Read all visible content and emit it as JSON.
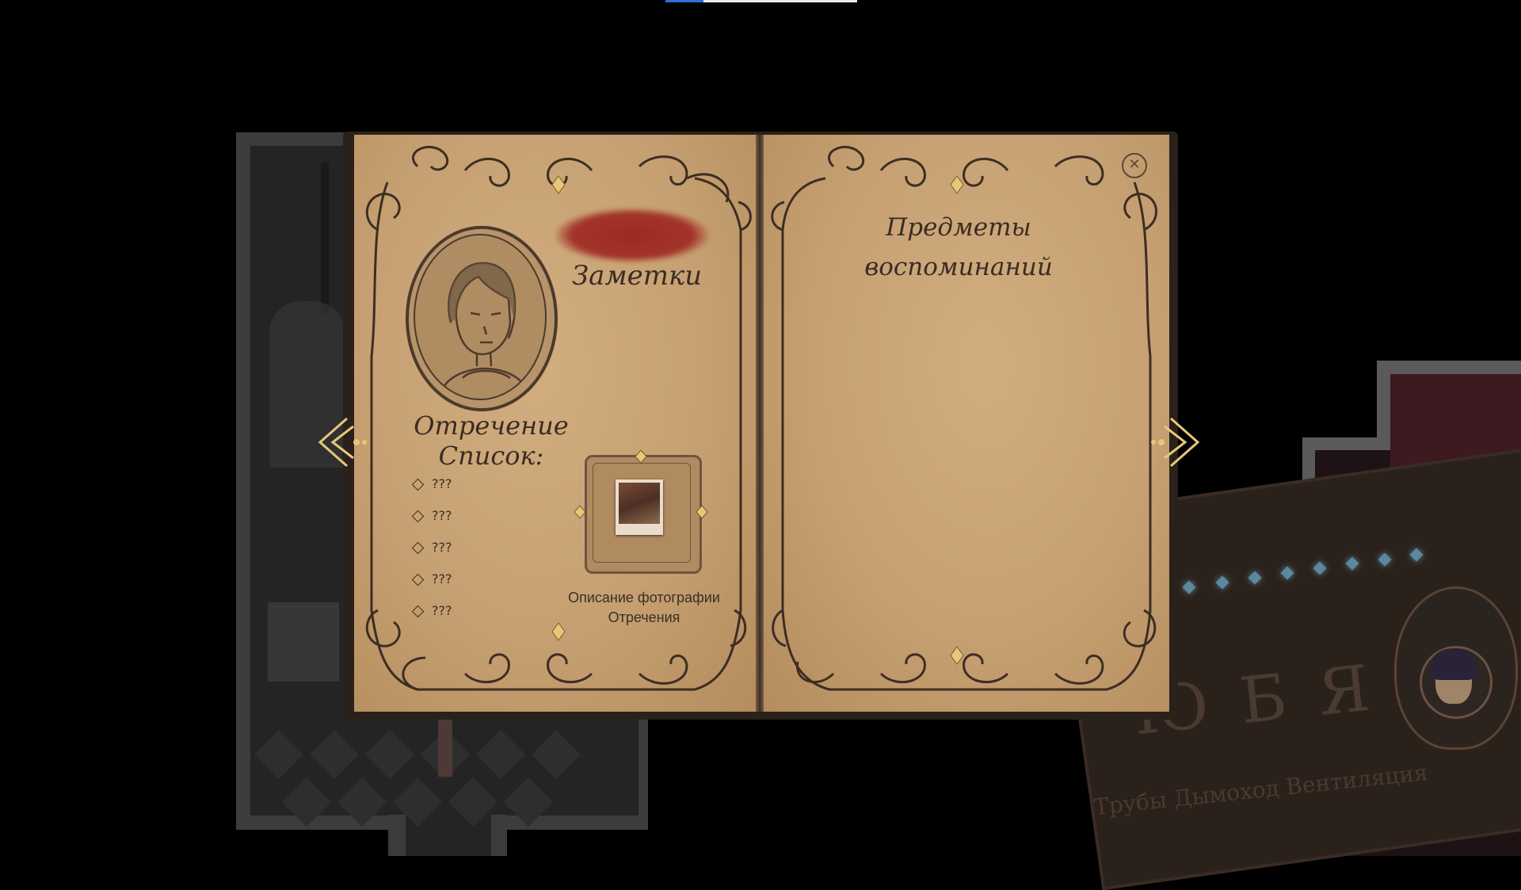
{
  "journal": {
    "left_page": {
      "notes_title": "Заметки",
      "renunciation_title_line1": "Отречение",
      "renunciation_title_line2": "Список:",
      "list_items": [
        "???",
        "???",
        "???",
        "???",
        "???"
      ],
      "photo_caption_line1": "Описание фотографии",
      "photo_caption_line2": "Отречения"
    },
    "right_page": {
      "title_line1": "Предметы",
      "title_line2": "воспоминаний"
    },
    "close_icon": "close-icon",
    "nav": {
      "prev_icon": "chevron-left-ornate-icon",
      "next_icon": "chevron-right-ornate-icon"
    }
  },
  "background": {
    "ouija_letters": "ЮБЯ",
    "ouija_words": "Трубы  Дымоход  Вентиляция"
  },
  "colors": {
    "page": "#c9a476",
    "ink": "#3a2c22",
    "redaction": "#a3342a",
    "accent_gold": "#e8c77a",
    "ouija_glow": "#6fb4d8"
  }
}
